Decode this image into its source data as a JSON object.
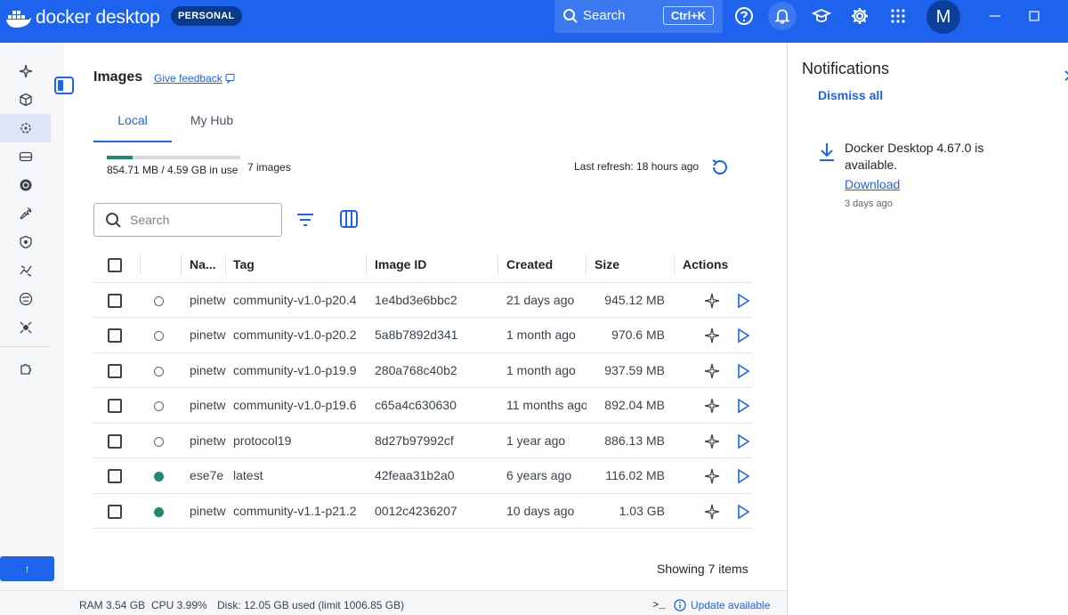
{
  "topbar": {
    "brand": "docker desktop",
    "plan": "PERSONAL",
    "search_label": "Search",
    "shortcut": "Ctrl+K",
    "avatar_initial": "M",
    "icons": [
      "help-icon",
      "bell-icon",
      "learn-icon",
      "gear-icon",
      "grid-icon"
    ]
  },
  "sidebar": {
    "items": [
      "containers-icon",
      "images-icon",
      "volumes-icon",
      "builds-icon",
      "kubernetes-icon",
      "dev-tools-icon",
      "scout-icon",
      "models-icon",
      "mcp-icon",
      "ai-icon",
      "extensions-icon"
    ],
    "active": "images-icon",
    "up_label": "↑"
  },
  "main": {
    "title": "Images",
    "feedback": "Give feedback",
    "tabs": [
      "Local",
      "My Hub"
    ],
    "active_tab": "Local",
    "usage_text": "854.71 MB / 4.59 GB in use",
    "usage_fraction": 0.19,
    "image_count": "7 images",
    "last_refresh": "Last refresh: 18 hours ago",
    "search_placeholder": "Search",
    "columns": [
      "Na...",
      "Tag",
      "Image ID",
      "Created",
      "Size",
      "Actions"
    ],
    "rows": [
      {
        "name": "pinetw",
        "tag": "community-v1.0-p20.4",
        "id": "1e4bd3e6bbc2",
        "created": "21 days ago",
        "size": "945.12 MB",
        "in_use": false
      },
      {
        "name": "pinetw",
        "tag": "community-v1.0-p20.2",
        "id": "5a8b7892d341",
        "created": "1 month ago",
        "size": "970.6 MB",
        "in_use": false
      },
      {
        "name": "pinetw",
        "tag": "community-v1.0-p19.9",
        "id": "280a768c40b2",
        "created": "1 month ago",
        "size": "937.59 MB",
        "in_use": false
      },
      {
        "name": "pinetw",
        "tag": "community-v1.0-p19.6",
        "id": "c65a4c630630",
        "created": "11 months ago",
        "size": "892.04 MB",
        "in_use": false
      },
      {
        "name": "pinetw",
        "tag": "protocol19",
        "id": "8d27b97992cf",
        "created": "1 year ago",
        "size": "886.13 MB",
        "in_use": false
      },
      {
        "name": "ese7e",
        "tag": "latest",
        "id": "42feaa31b2a0",
        "created": "6 years ago",
        "size": "116.02 MB",
        "in_use": true
      },
      {
        "name": "pinetw",
        "tag": "community-v1.1-p21.2",
        "id": "0012c4236207",
        "created": "10 days ago",
        "size": "1.03 GB",
        "in_use": true
      }
    ],
    "showing": "Showing 7 items"
  },
  "notifications": {
    "title": "Notifications",
    "dismiss_all": "Dismiss all",
    "items": [
      {
        "message": "Docker Desktop 4.67.0 is available.",
        "link": "Download",
        "time": "3 days ago"
      }
    ]
  },
  "footer": {
    "ram": "RAM 3.54 GB",
    "cpu": "CPU 3.99%",
    "disk": "Disk: 12.05 GB used (limit 1006.85 GB)",
    "terminal": ">_",
    "update": "Update available"
  },
  "colors": {
    "brand_blue": "#1d63ed",
    "in_use_green": "#21876f",
    "sidebar_bg": "#f6f7f9"
  }
}
